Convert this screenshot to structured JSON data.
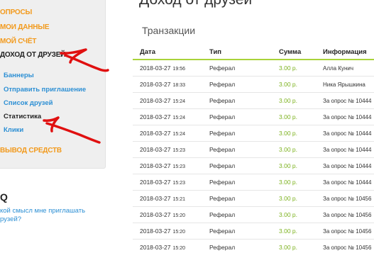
{
  "sidebar": {
    "menu": [
      {
        "label": "ОПРОСЫ",
        "active": false
      },
      {
        "label": "МОИ ДАННЫЕ",
        "active": false
      },
      {
        "label": "МОЙ СЧЁТ",
        "active": false
      },
      {
        "label": "ДОХОД ОТ ДРУЗЕЙ",
        "active": true
      }
    ],
    "submenu": [
      {
        "label": "Баннеры",
        "active": false
      },
      {
        "label": "Отправить приглашение",
        "active": false
      },
      {
        "label": "Список друзей",
        "active": false
      },
      {
        "label": "Статистика",
        "active": true
      },
      {
        "label": "Клики",
        "active": false
      }
    ],
    "withdraw_label": "ВЫВОД СРЕДСТВ"
  },
  "faq": {
    "title": "Q",
    "question_line1": "кой смысл мне приглашать",
    "question_line2": "рузей?"
  },
  "main": {
    "page_title": "Доход от друзей",
    "section_title": "Транзакции",
    "table": {
      "headers": [
        "Дата",
        "Тип",
        "Сумма",
        "Информация"
      ],
      "rows": [
        {
          "date": "2018-03-27",
          "time": "19:56",
          "type": "Реферал",
          "amount": "3.00 р.",
          "info": "Алла Кунич"
        },
        {
          "date": "2018-03-27",
          "time": "18:33",
          "type": "Реферал",
          "amount": "3.00 р.",
          "info": "Ника Ярышкина"
        },
        {
          "date": "2018-03-27",
          "time": "15:24",
          "type": "Реферал",
          "amount": "3.00 р.",
          "info": "За опрос № 10444"
        },
        {
          "date": "2018-03-27",
          "time": "15:24",
          "type": "Реферал",
          "amount": "3.00 р.",
          "info": "За опрос № 10444"
        },
        {
          "date": "2018-03-27",
          "time": "15:24",
          "type": "Реферал",
          "amount": "3.00 р.",
          "info": "За опрос № 10444"
        },
        {
          "date": "2018-03-27",
          "time": "15:23",
          "type": "Реферал",
          "amount": "3.00 р.",
          "info": "За опрос № 10444"
        },
        {
          "date": "2018-03-27",
          "time": "15:23",
          "type": "Реферал",
          "amount": "3.00 р.",
          "info": "За опрос № 10444"
        },
        {
          "date": "2018-03-27",
          "time": "15:23",
          "type": "Реферал",
          "amount": "3.00 р.",
          "info": "За опрос № 10444"
        },
        {
          "date": "2018-03-27",
          "time": "15:21",
          "type": "Реферал",
          "amount": "3.00 р.",
          "info": "За опрос № 10456"
        },
        {
          "date": "2018-03-27",
          "time": "15:20",
          "type": "Реферал",
          "amount": "3.00 р.",
          "info": "За опрос № 10456"
        },
        {
          "date": "2018-03-27",
          "time": "15:20",
          "type": "Реферал",
          "amount": "3.00 р.",
          "info": "За опрос № 10456"
        },
        {
          "date": "2018-03-27",
          "time": "15:20",
          "type": "Реферал",
          "amount": "3.00 р.",
          "info": "За опрос № 10456"
        }
      ]
    }
  },
  "colors": {
    "menu_orange": "#f29a1d",
    "link_blue": "#2c8fd4",
    "amount_green": "#7cb21e",
    "header_rule": "#a9d33a",
    "marker_red": "#e01010"
  }
}
